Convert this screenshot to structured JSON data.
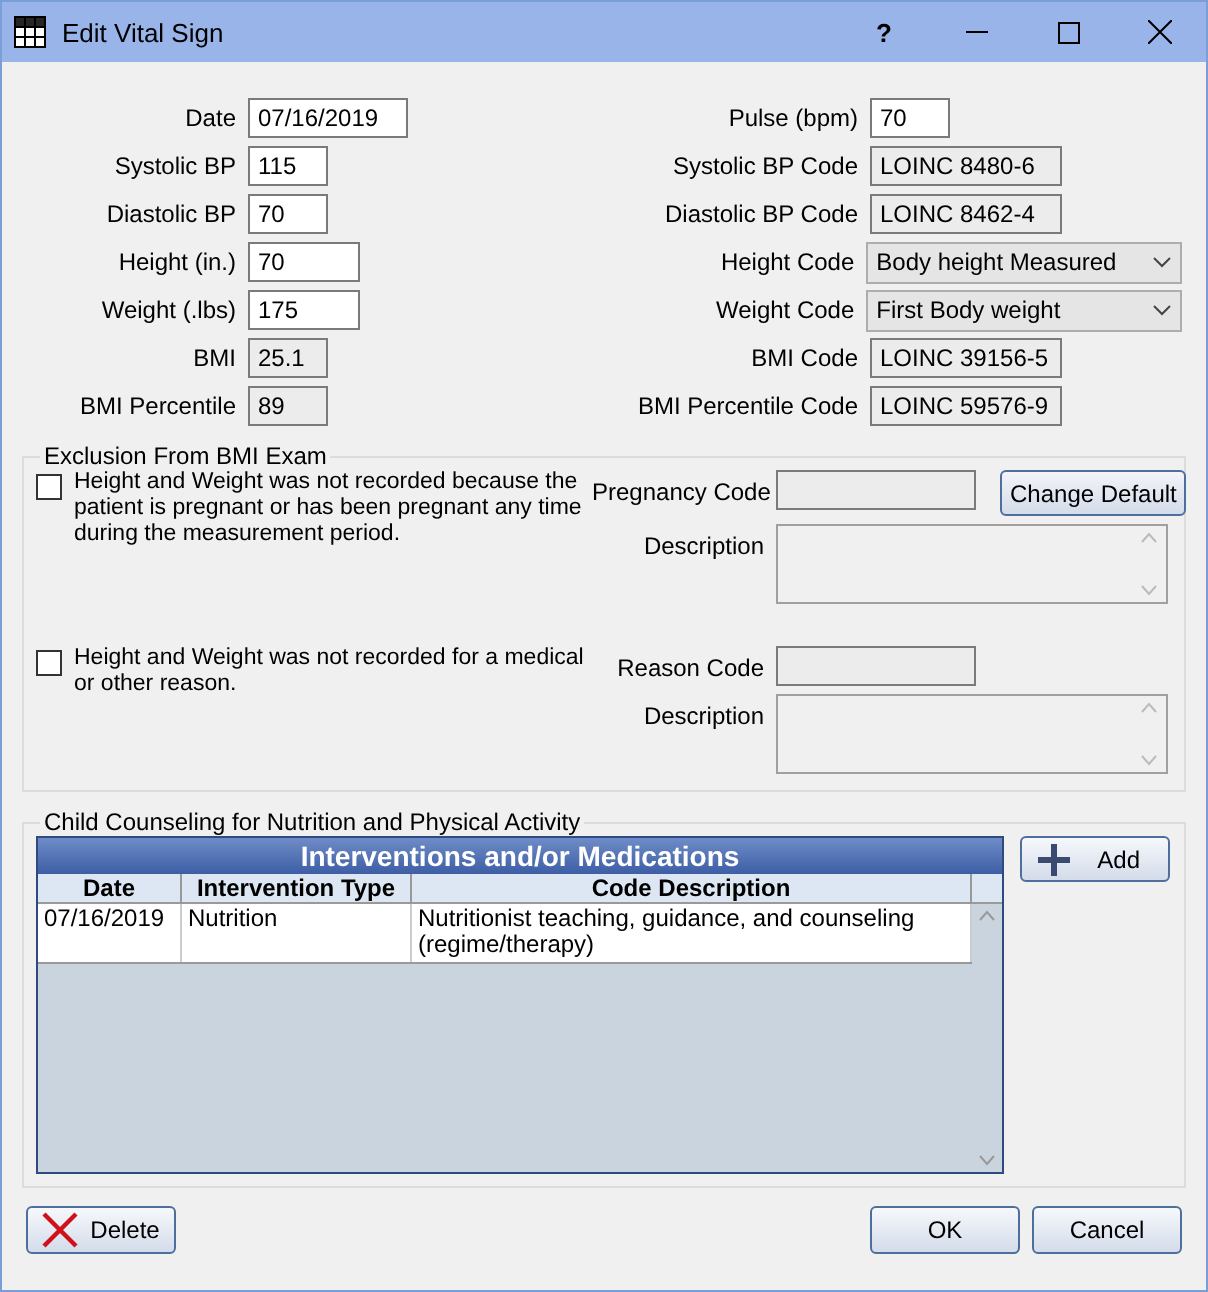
{
  "window": {
    "title": "Edit Vital Sign",
    "controls": [
      "?"
    ]
  },
  "left_fields": [
    {
      "label": "Date",
      "value": "07/16/2019",
      "disabled": false
    },
    {
      "label": "Systolic BP",
      "value": "115",
      "disabled": false
    },
    {
      "label": "Diastolic BP",
      "value": "70",
      "disabled": false
    },
    {
      "label": "Height (in.)",
      "value": "70",
      "disabled": false
    },
    {
      "label": "Weight (.lbs)",
      "value": "175",
      "disabled": false
    },
    {
      "label": "BMI",
      "value": "25.1",
      "disabled": true
    },
    {
      "label": "BMI Percentile",
      "value": "89",
      "disabled": true
    }
  ],
  "right_fields": [
    {
      "label": "Pulse (bpm)",
      "value": "70",
      "kind": "input",
      "disabled": false
    },
    {
      "label": "Systolic BP Code",
      "value": "LOINC 8480-6",
      "kind": "input",
      "disabled": true
    },
    {
      "label": "Diastolic BP Code",
      "value": "LOINC 8462-4",
      "kind": "input",
      "disabled": true
    },
    {
      "label": "Height Code",
      "value": "Body height Measured",
      "kind": "dropdown",
      "disabled": false
    },
    {
      "label": "Weight Code",
      "value": "First Body weight",
      "kind": "dropdown",
      "disabled": false
    },
    {
      "label": "BMI Code",
      "value": "LOINC 39156-5",
      "kind": "input",
      "disabled": true
    },
    {
      "label": "BMI Percentile Code",
      "value": "LOINC 59576-9",
      "kind": "input",
      "disabled": true
    }
  ],
  "exclusion": {
    "title": "Exclusion From BMI Exam",
    "items": [
      {
        "text": "Height and Weight was not recorded because the patient is pregnant or has been pregnant any time during the measurement period.",
        "checked": false,
        "code_label": "Pregnancy Code",
        "button": "Change Default",
        "description_label": "Description"
      },
      {
        "text": "Height and Weight was not recorded for a medical or other reason.",
        "checked": false,
        "code_label": "Reason Code",
        "description_label": "Description"
      }
    ]
  },
  "counseling": {
    "title": "Child Counseling for Nutrition and Physical Activity",
    "grid_title": "Interventions and/or Medications",
    "columns": [
      "Date",
      "Intervention Type",
      "Code Description"
    ],
    "rows": [
      {
        "cells": [
          "07/16/2019",
          "Nutrition",
          "Nutritionist teaching, guidance, and counseling (regime/therapy)"
        ]
      }
    ],
    "add_button": "Add"
  },
  "buttons": {
    "delete": "Delete",
    "ok": "OK",
    "cancel": "Cancel"
  }
}
